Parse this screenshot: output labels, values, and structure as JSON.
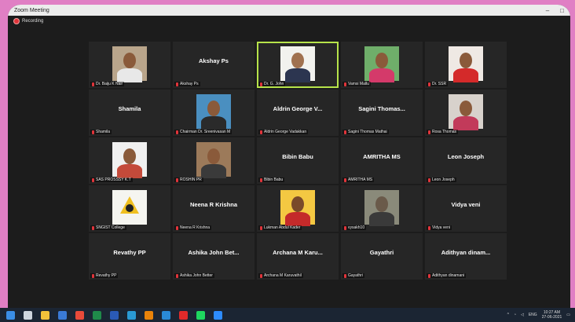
{
  "window": {
    "title": "Zoom Meeting",
    "controls": [
      "–",
      "□"
    ]
  },
  "recording": "Recording",
  "participants": [
    {
      "big": "",
      "label": "Dr. Baiju K Nair",
      "video": true,
      "bg": "#b9a58b",
      "skin": "#8a5a3a",
      "shirt": "#e8e8e8"
    },
    {
      "big": "Akshay Ps",
      "label": "Akshay Ps",
      "video": false
    },
    {
      "big": "",
      "label": "Dr. G. John",
      "video": true,
      "bg": "#f2f2ee",
      "skin": "#a0714f",
      "shirt": "#2c3550",
      "active": true
    },
    {
      "big": "",
      "label": "Vamsi Mallu",
      "video": true,
      "bg": "#6fae6a",
      "skin": "#8a5a3a",
      "shirt": "#d43a6a"
    },
    {
      "big": "",
      "label": "Dr. SSR",
      "video": true,
      "bg": "#efe9e4",
      "skin": "#8a5a3a",
      "shirt": "#d42a2a"
    },
    {
      "big": "Shamila",
      "label": "Shamila",
      "video": false
    },
    {
      "big": "",
      "label": "Chairman Dr. Sreenivasan M",
      "video": true,
      "bg": "#4a8fc0",
      "skin": "#8a5a3a",
      "shirt": "#2a2a2a"
    },
    {
      "big": "Aldrin George V...",
      "label": "Aldrin George Vadakkan",
      "video": false
    },
    {
      "big": "Sagini Thomas...",
      "label": "Sagini Thomas Mathai",
      "video": false
    },
    {
      "big": "",
      "label": "Rosa Thomas",
      "video": true,
      "bg": "#d8d2cc",
      "skin": "#8a5a3a",
      "shirt": "#c23a5a"
    },
    {
      "big": "",
      "label": "SAS PROSSSY K.T",
      "video": true,
      "bg": "#f0f0f0",
      "skin": "#8a5a3a",
      "shirt": "#c44a3a"
    },
    {
      "big": "",
      "label": "ROSHIN PR",
      "video": true,
      "bg": "#9c7a5a",
      "skin": "#8a5a3a",
      "shirt": "#3a3a3a"
    },
    {
      "big": "Bibin Babu",
      "label": "Bibin Babu",
      "video": false
    },
    {
      "big": "AMRITHA MS",
      "label": "AMRITHA MS",
      "video": false
    },
    {
      "big": "Leon Joseph",
      "label": "Leon Joseph",
      "video": false
    },
    {
      "big": "",
      "label": "SNGIST College",
      "video": true,
      "bg": "#f5f5f0",
      "skin": "#222222",
      "shirt": "#f0c020",
      "logo": true
    },
    {
      "big": "Neena R Krishna",
      "label": "Neena R Krishna",
      "video": false
    },
    {
      "big": "",
      "label": "Lukman Abdul Kader",
      "video": true,
      "bg": "#f4c842",
      "skin": "#7a4a2a",
      "shirt": "#c42a2a"
    },
    {
      "big": "",
      "label": "vysakh10",
      "video": true,
      "bg": "#8a8a7a",
      "skin": "#6a5a4a",
      "shirt": "#3a3a3a"
    },
    {
      "big": "Vidya veni",
      "label": "Vidya veni",
      "video": false
    },
    {
      "big": "Revathy PP",
      "label": "Revathy PP",
      "video": false
    },
    {
      "big": "Ashika John Bet...",
      "label": "Ashika John Better",
      "video": false
    },
    {
      "big": "Archana M Karu...",
      "label": "Archana M Karuvathil",
      "video": false
    },
    {
      "big": "Gayathri",
      "label": "Gayathri",
      "video": false
    },
    {
      "big": "Adithyan dinam...",
      "label": "Adithyan dinamani",
      "video": false
    }
  ],
  "taskbar": {
    "icons": [
      {
        "name": "windows-start-icon",
        "color": "#3a8ee6"
      },
      {
        "name": "task-view-icon",
        "color": "#cfd6de"
      },
      {
        "name": "file-explorer-icon",
        "color": "#f2c23a"
      },
      {
        "name": "mail-icon",
        "color": "#3a7ad6"
      },
      {
        "name": "chrome-icon",
        "color": "#e84a3a"
      },
      {
        "name": "excel-icon",
        "color": "#1f8a4a"
      },
      {
        "name": "word-icon",
        "color": "#2a5ab6"
      },
      {
        "name": "edge-icon",
        "color": "#2a9ad6"
      },
      {
        "name": "illustrator-icon",
        "color": "#e8830a"
      },
      {
        "name": "photoshop-icon",
        "color": "#2a8ad6"
      },
      {
        "name": "opera-icon",
        "color": "#e02a2a"
      },
      {
        "name": "spotify-icon",
        "color": "#1ed760"
      },
      {
        "name": "zoom-icon",
        "color": "#2d8cff"
      }
    ],
    "tray": {
      "lang": "ENG",
      "time": "10:27 AM",
      "date": "27-06-2021"
    }
  }
}
